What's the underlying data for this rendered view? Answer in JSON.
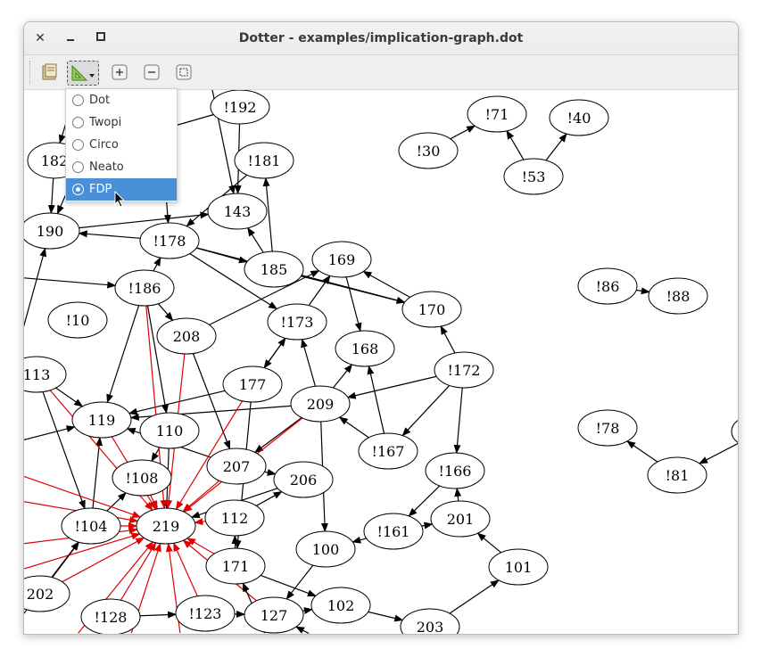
{
  "window": {
    "title": "Dotter - examples/implication-graph.dot",
    "close_glyph": "✕",
    "minimize_glyph": "▁",
    "maximize_glyph": "▢"
  },
  "toolbar": {
    "tools": [
      "open-file-icon",
      "layout-engine-icon",
      "zoom-in-icon",
      "zoom-out-icon",
      "zoom-fit-icon"
    ]
  },
  "layout_menu": {
    "items": [
      {
        "label": "Dot",
        "selected": false
      },
      {
        "label": "Twopi",
        "selected": false
      },
      {
        "label": "Circo",
        "selected": false
      },
      {
        "label": "Neato",
        "selected": false
      },
      {
        "label": "FDP",
        "selected": true
      }
    ]
  },
  "graph": {
    "nodes": [
      {
        "id": "n192",
        "label": "!192"
      },
      {
        "id": "n181",
        "label": "!181"
      },
      {
        "id": "n182",
        "label": "182"
      },
      {
        "id": "n190",
        "label": "190"
      },
      {
        "id": "n143",
        "label": "143"
      },
      {
        "id": "n178",
        "label": "!178"
      },
      {
        "id": "n185",
        "label": "185"
      },
      {
        "id": "n169",
        "label": "169"
      },
      {
        "id": "n186",
        "label": "!186"
      },
      {
        "id": "n10",
        "label": "!10"
      },
      {
        "id": "n208",
        "label": "208"
      },
      {
        "id": "n173",
        "label": "!173"
      },
      {
        "id": "n170",
        "label": "170"
      },
      {
        "id": "n168",
        "label": "168"
      },
      {
        "id": "n113",
        "label": "113"
      },
      {
        "id": "n177",
        "label": "177"
      },
      {
        "id": "n209",
        "label": "209"
      },
      {
        "id": "n172",
        "label": "!172"
      },
      {
        "id": "n119",
        "label": "119"
      },
      {
        "id": "n110",
        "label": "110"
      },
      {
        "id": "n167",
        "label": "!167"
      },
      {
        "id": "n108",
        "label": "!108"
      },
      {
        "id": "n207",
        "label": "207"
      },
      {
        "id": "n206",
        "label": "206"
      },
      {
        "id": "n166",
        "label": "!166"
      },
      {
        "id": "n219",
        "label": "219"
      },
      {
        "id": "n104",
        "label": "!104"
      },
      {
        "id": "n112",
        "label": "112"
      },
      {
        "id": "n201",
        "label": "201"
      },
      {
        "id": "n161",
        "label": "!161"
      },
      {
        "id": "n100",
        "label": "100"
      },
      {
        "id": "n171",
        "label": "171"
      },
      {
        "id": "n101",
        "label": "101"
      },
      {
        "id": "n202",
        "label": "202"
      },
      {
        "id": "n102",
        "label": "102"
      },
      {
        "id": "n128",
        "label": "!128"
      },
      {
        "id": "n123",
        "label": "!123"
      },
      {
        "id": "n127",
        "label": "127"
      },
      {
        "id": "n203",
        "label": "203"
      },
      {
        "id": "n71",
        "label": "!71"
      },
      {
        "id": "n40",
        "label": "!40"
      },
      {
        "id": "n30",
        "label": "!30"
      },
      {
        "id": "n53",
        "label": "!53"
      },
      {
        "id": "n86",
        "label": "!86"
      },
      {
        "id": "n88",
        "label": "!88"
      },
      {
        "id": "n78",
        "label": "!78"
      },
      {
        "id": "n81",
        "label": "!81"
      }
    ]
  },
  "colors": {
    "selection": "#4a90d9",
    "edge": "#000000",
    "highlight_edge": "#e00000"
  }
}
